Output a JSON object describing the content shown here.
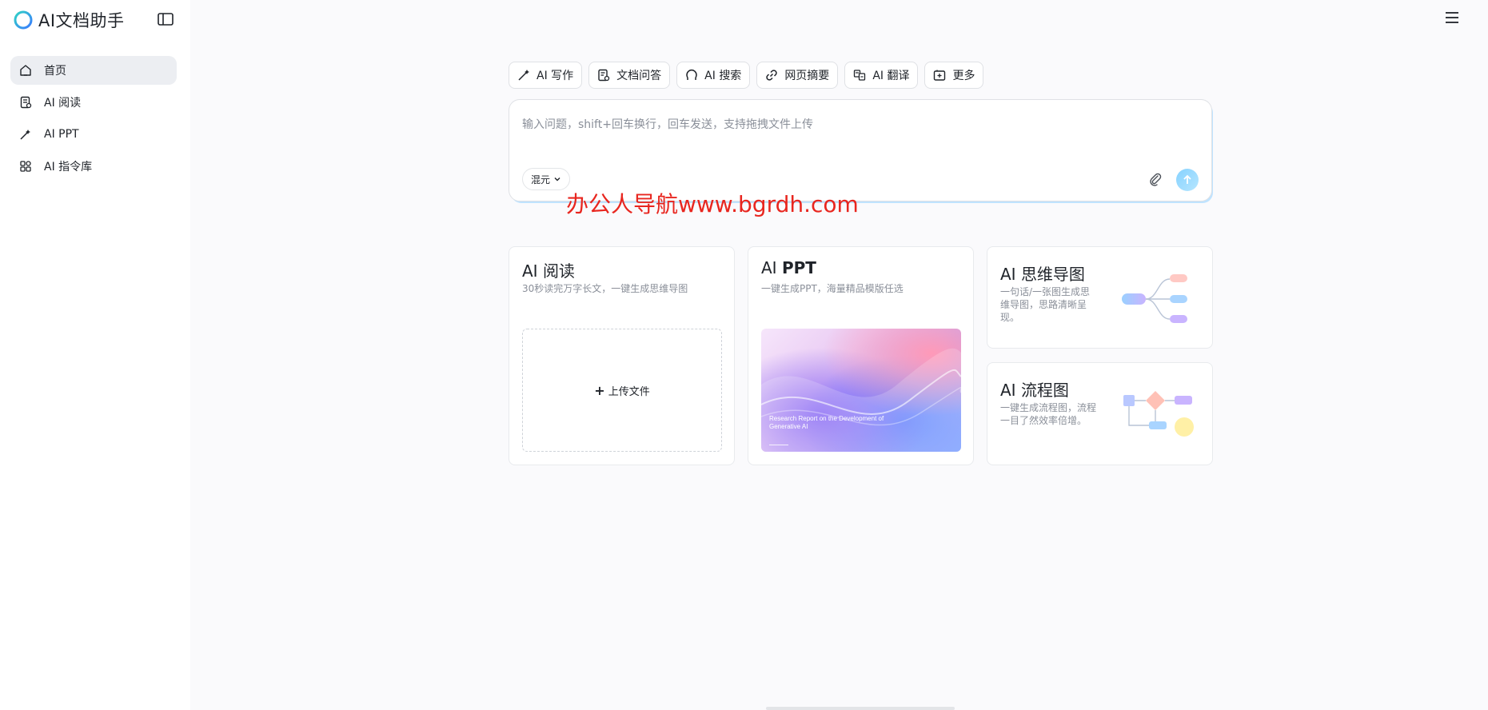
{
  "app": {
    "title": "AI文档助手"
  },
  "sidebar": {
    "items": [
      {
        "label": "首页",
        "icon": "home-icon",
        "active": true
      },
      {
        "label": "AI 阅读",
        "icon": "document-icon",
        "active": false
      },
      {
        "label": "AI PPT",
        "icon": "magic-wand-icon",
        "active": false
      },
      {
        "label": "AI 指令库",
        "icon": "grid-icon",
        "active": false
      }
    ]
  },
  "toolbar": {
    "items": [
      {
        "label": "AI 写作",
        "icon": "pen-wand-icon"
      },
      {
        "label": "文档问答",
        "icon": "doc-question-icon"
      },
      {
        "label": "AI 搜索",
        "icon": "search-icon"
      },
      {
        "label": "网页摘要",
        "icon": "link-icon"
      },
      {
        "label": "AI 翻译",
        "icon": "translate-icon"
      },
      {
        "label": "更多",
        "icon": "more-box-icon"
      }
    ]
  },
  "chat": {
    "placeholder": "输入问题，shift+回车换行，回车发送，支持拖拽文件上传",
    "model": "混元"
  },
  "watermark": "办公人导航www.bgrdh.com",
  "cards": {
    "reading": {
      "title": "AI 阅读",
      "desc": "30秒读完万字长文，一键生成思维导图",
      "upload_label": "上传文件"
    },
    "ppt": {
      "title_prefix": "AI ",
      "title_main": "PPT",
      "desc": "一键生成PPT，海量精品模版任选",
      "cover_title": "Research Report on the Development of Generative AI"
    },
    "mindmap": {
      "title": "AI 思维导图",
      "desc": "一句话/一张图生成思维导图，思路清晰呈现。"
    },
    "flowchart": {
      "title": "AI 流程图",
      "desc": "一键生成流程图，流程一目了然效率倍增。"
    }
  },
  "colors": {
    "accent": "#86d2ff",
    "watermark": "#e8261f",
    "active_nav": "#eceef2"
  }
}
